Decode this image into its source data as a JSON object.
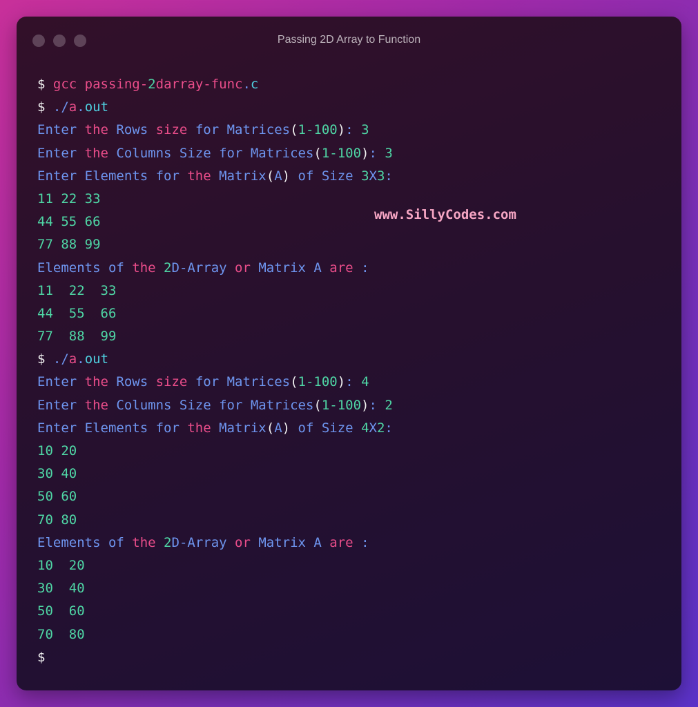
{
  "window": {
    "title": "Passing 2D Array to Function",
    "buttons": [
      "close",
      "minimize",
      "maximize"
    ]
  },
  "watermark": "www.SillyCodes.com",
  "colors": {
    "prompt": "#f2f2f2",
    "keyword": "#ea4d8a",
    "text": "#6e95ef",
    "number": "#4fd6a5",
    "extension": "#4fd0e0",
    "paren": "#f0f0f0"
  },
  "terminal": {
    "lines": [
      [
        {
          "t": "$ ",
          "c": "prompt"
        },
        {
          "t": "gcc passing-",
          "c": "pink"
        },
        {
          "t": "2",
          "c": "green"
        },
        {
          "t": "darray-func",
          "c": "pink"
        },
        {
          "t": ".",
          "c": "blue"
        },
        {
          "t": "c",
          "c": "cyan"
        }
      ],
      [
        {
          "t": "$ ",
          "c": "prompt"
        },
        {
          "t": "./",
          "c": "blue"
        },
        {
          "t": "a",
          "c": "pink"
        },
        {
          "t": ".",
          "c": "blue"
        },
        {
          "t": "out",
          "c": "cyan"
        }
      ],
      [
        {
          "t": "Enter ",
          "c": "blue"
        },
        {
          "t": "the ",
          "c": "pink"
        },
        {
          "t": "Rows ",
          "c": "blue"
        },
        {
          "t": "size ",
          "c": "pink"
        },
        {
          "t": "for Matrices",
          "c": "blue"
        },
        {
          "t": "(",
          "c": "white"
        },
        {
          "t": "1-100",
          "c": "green"
        },
        {
          "t": ")",
          "c": "white"
        },
        {
          "t": ": ",
          "c": "blue"
        },
        {
          "t": "3",
          "c": "green"
        }
      ],
      [
        {
          "t": "Enter ",
          "c": "blue"
        },
        {
          "t": "the ",
          "c": "pink"
        },
        {
          "t": "Columns Size for Matrices",
          "c": "blue"
        },
        {
          "t": "(",
          "c": "white"
        },
        {
          "t": "1-100",
          "c": "green"
        },
        {
          "t": ")",
          "c": "white"
        },
        {
          "t": ": ",
          "c": "blue"
        },
        {
          "t": "3",
          "c": "green"
        }
      ],
      [
        {
          "t": "Enter Elements for ",
          "c": "blue"
        },
        {
          "t": "the ",
          "c": "pink"
        },
        {
          "t": "Matrix",
          "c": "blue"
        },
        {
          "t": "(",
          "c": "white"
        },
        {
          "t": "A",
          "c": "blue"
        },
        {
          "t": ")",
          "c": "white"
        },
        {
          "t": " of Size ",
          "c": "blue"
        },
        {
          "t": "3",
          "c": "green"
        },
        {
          "t": "X",
          "c": "blue"
        },
        {
          "t": "3",
          "c": "green"
        },
        {
          "t": ":",
          "c": "blue"
        }
      ],
      [
        {
          "t": "11 22 33",
          "c": "green"
        }
      ],
      [
        {
          "t": "44 55 66",
          "c": "green"
        }
      ],
      [
        {
          "t": "77 88 99",
          "c": "green"
        }
      ],
      [
        {
          "t": "Elements of ",
          "c": "blue"
        },
        {
          "t": "the ",
          "c": "pink"
        },
        {
          "t": "2",
          "c": "green"
        },
        {
          "t": "D-Array ",
          "c": "blue"
        },
        {
          "t": "or ",
          "c": "pink"
        },
        {
          "t": "Matrix A ",
          "c": "blue"
        },
        {
          "t": "are ",
          "c": "pink"
        },
        {
          "t": ":",
          "c": "blue"
        }
      ],
      [
        {
          "t": "11  22  33",
          "c": "green"
        }
      ],
      [
        {
          "t": "44  55  66",
          "c": "green"
        }
      ],
      [
        {
          "t": "77  88  99",
          "c": "green"
        }
      ],
      [
        {
          "t": "$ ",
          "c": "prompt"
        },
        {
          "t": "./",
          "c": "blue"
        },
        {
          "t": "a",
          "c": "pink"
        },
        {
          "t": ".",
          "c": "blue"
        },
        {
          "t": "out",
          "c": "cyan"
        }
      ],
      [
        {
          "t": "Enter ",
          "c": "blue"
        },
        {
          "t": "the ",
          "c": "pink"
        },
        {
          "t": "Rows ",
          "c": "blue"
        },
        {
          "t": "size ",
          "c": "pink"
        },
        {
          "t": "for Matrices",
          "c": "blue"
        },
        {
          "t": "(",
          "c": "white"
        },
        {
          "t": "1-100",
          "c": "green"
        },
        {
          "t": ")",
          "c": "white"
        },
        {
          "t": ": ",
          "c": "blue"
        },
        {
          "t": "4",
          "c": "green"
        }
      ],
      [
        {
          "t": "Enter ",
          "c": "blue"
        },
        {
          "t": "the ",
          "c": "pink"
        },
        {
          "t": "Columns Size for Matrices",
          "c": "blue"
        },
        {
          "t": "(",
          "c": "white"
        },
        {
          "t": "1-100",
          "c": "green"
        },
        {
          "t": ")",
          "c": "white"
        },
        {
          "t": ": ",
          "c": "blue"
        },
        {
          "t": "2",
          "c": "green"
        }
      ],
      [
        {
          "t": "Enter Elements for ",
          "c": "blue"
        },
        {
          "t": "the ",
          "c": "pink"
        },
        {
          "t": "Matrix",
          "c": "blue"
        },
        {
          "t": "(",
          "c": "white"
        },
        {
          "t": "A",
          "c": "blue"
        },
        {
          "t": ")",
          "c": "white"
        },
        {
          "t": " of Size ",
          "c": "blue"
        },
        {
          "t": "4",
          "c": "green"
        },
        {
          "t": "X",
          "c": "blue"
        },
        {
          "t": "2",
          "c": "green"
        },
        {
          "t": ":",
          "c": "blue"
        }
      ],
      [
        {
          "t": "10 20",
          "c": "green"
        }
      ],
      [
        {
          "t": "30 40",
          "c": "green"
        }
      ],
      [
        {
          "t": "50 60",
          "c": "green"
        }
      ],
      [
        {
          "t": "70 80",
          "c": "green"
        }
      ],
      [
        {
          "t": "Elements of ",
          "c": "blue"
        },
        {
          "t": "the ",
          "c": "pink"
        },
        {
          "t": "2",
          "c": "green"
        },
        {
          "t": "D-Array ",
          "c": "blue"
        },
        {
          "t": "or ",
          "c": "pink"
        },
        {
          "t": "Matrix A ",
          "c": "blue"
        },
        {
          "t": "are ",
          "c": "pink"
        },
        {
          "t": ":",
          "c": "blue"
        }
      ],
      [
        {
          "t": "10  20",
          "c": "green"
        }
      ],
      [
        {
          "t": "30  40",
          "c": "green"
        }
      ],
      [
        {
          "t": "50  60",
          "c": "green"
        }
      ],
      [
        {
          "t": "70  80",
          "c": "green"
        }
      ],
      [
        {
          "t": "$",
          "c": "prompt"
        }
      ]
    ]
  }
}
